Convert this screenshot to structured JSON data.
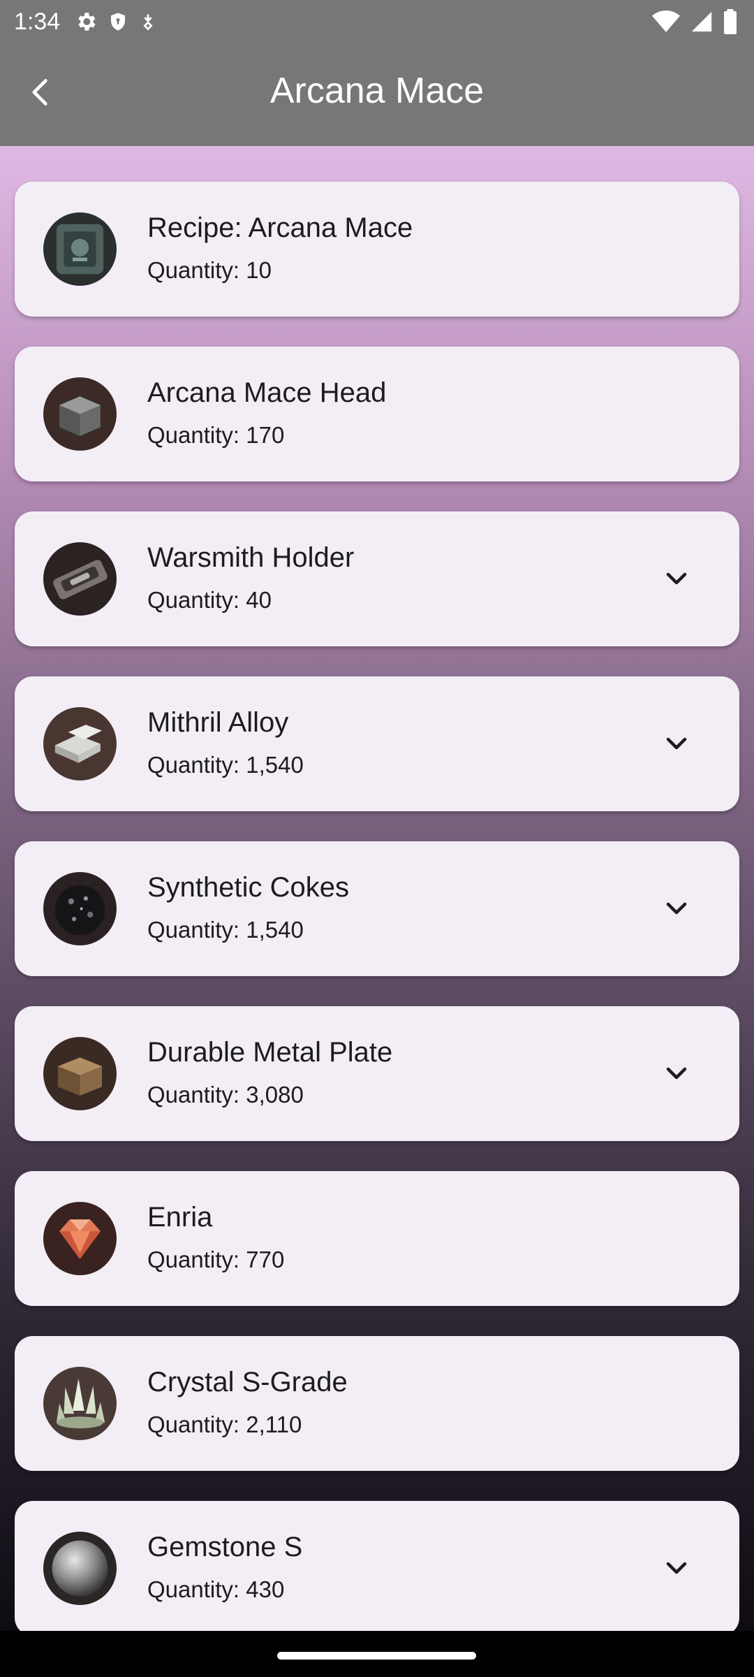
{
  "status_bar": {
    "time": "1:34"
  },
  "app_bar": {
    "title": "Arcana Mace"
  },
  "items": [
    {
      "name": "Recipe: Arcana Mace",
      "quantity": "Quantity: 10",
      "icon": "recipe-icon",
      "expandable": false
    },
    {
      "name": "Arcana Mace Head",
      "quantity": "Quantity: 170",
      "icon": "mace-head-icon",
      "expandable": false
    },
    {
      "name": "Warsmith Holder",
      "quantity": "Quantity: 40",
      "icon": "holder-icon",
      "expandable": true
    },
    {
      "name": "Mithril Alloy",
      "quantity": "Quantity: 1,540",
      "icon": "alloy-icon",
      "expandable": true
    },
    {
      "name": "Synthetic Cokes",
      "quantity": "Quantity: 1,540",
      "icon": "cokes-icon",
      "expandable": true
    },
    {
      "name": "Durable Metal Plate",
      "quantity": "Quantity: 3,080",
      "icon": "metal-plate-icon",
      "expandable": true
    },
    {
      "name": "Enria",
      "quantity": "Quantity: 770",
      "icon": "enria-icon",
      "expandable": false
    },
    {
      "name": "Crystal S-Grade",
      "quantity": "Quantity: 2,110",
      "icon": "crystal-icon",
      "expandable": false
    },
    {
      "name": "Gemstone S",
      "quantity": "Quantity: 430",
      "icon": "gemstone-icon",
      "expandable": true
    }
  ]
}
